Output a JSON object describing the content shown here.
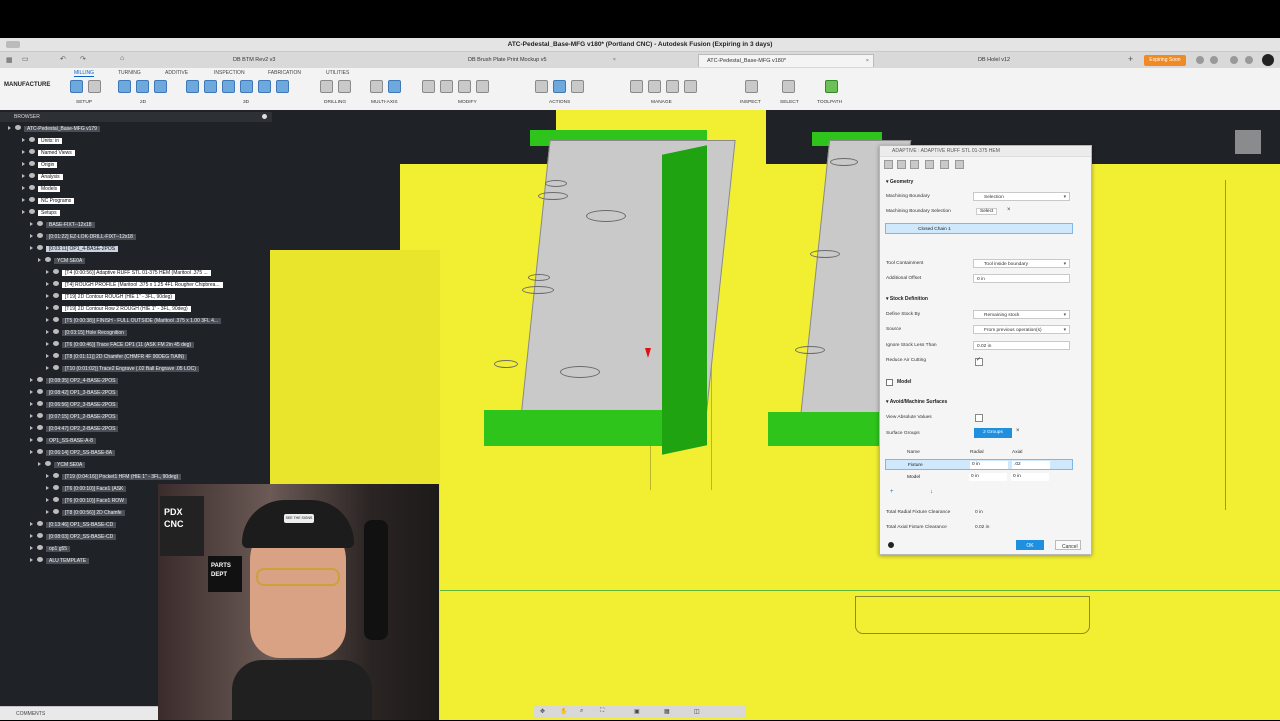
{
  "window": {
    "title": "ATC-Pedestal_Base-MFG v180* (Portland CNC) - Autodesk Fusion (Expiring in 3 days)"
  },
  "doc_tabs": [
    {
      "label": "DB BTM Rev2 v3"
    },
    {
      "label": "DB Brush Plate Print Mockup v5"
    },
    {
      "label": "ATC-Pedestal_Base-MFG v180*"
    },
    {
      "label": "DB Holel v12"
    }
  ],
  "expiring_badge": "Expiring Soon",
  "toolbar": {
    "workspace": "MANUFACTURE",
    "tabs": [
      "MILLING",
      "TURNING",
      "ADDITIVE",
      "INSPECTION",
      "FABRICATION",
      "UTILITIES"
    ],
    "groups": [
      "SETUP",
      "2D",
      "3D",
      "DRILLING",
      "MULTI-AXIS",
      "MODIFY",
      "ACTIONS",
      "MANAGE",
      "INSPECT",
      "SELECT",
      "TOOLPATH"
    ]
  },
  "browser": {
    "header": "BROWSER",
    "rows": [
      {
        "label": "ATC-Pedestal_Base-MFG v179",
        "style": "dark"
      },
      {
        "label": "Units: in",
        "style": "plain"
      },
      {
        "label": "Named Views",
        "style": "plain"
      },
      {
        "label": "Origin",
        "style": "plain"
      },
      {
        "label": "Analysis",
        "style": "plain"
      },
      {
        "label": "Models",
        "style": "plain"
      },
      {
        "label": "NC Programs",
        "style": "plain"
      },
      {
        "label": "Setups",
        "style": "plain"
      },
      {
        "label": "BASE-FIXT--12x18",
        "style": "dark"
      },
      {
        "label": "[0:01:22] EZ-LOK-DRILL-FIXT--12x18",
        "style": "dark"
      },
      {
        "label": "[0:03:11] OP1_4-BASE-2POS",
        "style": "sel"
      },
      {
        "label": "YCM SE0A",
        "style": "dark"
      },
      {
        "label": "[T4 (0:00:56)] Adaptive RUFF STL 01-375 HEM (Maritool .375 ...",
        "style": "plain"
      },
      {
        "label": "[T4] ROUGH PROFILE (Maritool .375 x 1.25 4FL Rougher Chipbrea...",
        "style": "plain"
      },
      {
        "label": "[T19] 2D Contour ROUGH (HIE 1\" - 3FL, 90deg)",
        "style": "plain"
      },
      {
        "label": "[T19] 2D Contour Row 2 ROUGH (HIE 1\" - 3FL, 90deg)",
        "style": "plain"
      },
      {
        "label": "[T5 (0:00:38)] FINISH - FULL OUTSIDE (Maritool .375 x 1.00 3FL 4...",
        "style": "dark"
      },
      {
        "label": "[0:03:15] Hole Recognition",
        "style": "dark"
      },
      {
        "label": "[T6 (0:00:46)] Trace FACE OP1 (11 (ASK FM 2in 45 deg)",
        "style": "dark"
      },
      {
        "label": "[T8 (0:01:11)] 2D Chamfer (CHMFR 4F 90DEG TiAlN)",
        "style": "dark"
      },
      {
        "label": "[T10 (0:01:02)] Trace2 Engrave (.02 Ball Engrave .05 LOC)",
        "style": "dark"
      },
      {
        "label": "[0:08:35] OP2_4-BASE-2POS",
        "style": "dark"
      },
      {
        "label": "[0:08:42] OP1_3-BASE-2POS",
        "style": "dark"
      },
      {
        "label": "[0:06:56] OP2_3-BASE-2POS",
        "style": "dark"
      },
      {
        "label": "[0:07:15] OP1_2-BASE-2POS",
        "style": "dark"
      },
      {
        "label": "[0:04:47] OP2_2-BASE-2POS",
        "style": "dark"
      },
      {
        "label": "OP1_SS-BASE-A-8",
        "style": "dark"
      },
      {
        "label": "[0:06:14] OP2_SS-BASE-8A",
        "style": "dark"
      },
      {
        "label": "YCM SE0A",
        "style": "dark"
      },
      {
        "label": "[T19 (0:04:16)] Pocket1 HFM (HIE 1\" - 3FL, 90deg)",
        "style": "dark"
      },
      {
        "label": "[T6 (0:00:10)] Face1 (ASK",
        "style": "dark"
      },
      {
        "label": "[T6 (0:00:10)] Face1 ROW",
        "style": "dark"
      },
      {
        "label": "[T8 (0:00:56)] 2D Chamfe",
        "style": "dark"
      },
      {
        "label": "[0:13:46] OP1_SS-BASE-CD",
        "style": "dark"
      },
      {
        "label": "[0:08:03] OP2_SS-BASE-CD",
        "style": "dark"
      },
      {
        "label": "op1 g55",
        "style": "dark"
      },
      {
        "label": "ALU TEMPLATE",
        "style": "dark"
      }
    ]
  },
  "dialog": {
    "title": "ADAPTIVE : ADAPTIVE RUFF STL 01-375 HEM",
    "geometry": {
      "section": "Geometry",
      "machining_boundary_label": "Machining Boundary",
      "machining_boundary_value": "Selection",
      "boundary_selection_label": "Machining Boundary Selection",
      "boundary_selection_value": "Select",
      "closed_chain": "Closed Chain 1",
      "tool_containment_label": "Tool Containment",
      "tool_containment_value": "Tool inside boundary",
      "additional_offset_label": "Additional Offset",
      "additional_offset_value": "0 in"
    },
    "stock": {
      "section": "Stock Definition",
      "define_stock_label": "Define Stock By",
      "define_stock_value": "Remaining stock",
      "source_label": "Source",
      "source_value": "From previous operation(s)",
      "ignore_label": "Ignore Stock Less Than",
      "ignore_value": "0.02 in",
      "reduce_label": "Reduce Air Cutting"
    },
    "model": {
      "section": "Model"
    },
    "avoid": {
      "section": "Avoid/Machine Surfaces",
      "view_abs_label": "View Absolute Values",
      "surface_groups_label": "Surface Groups",
      "surface_groups_value": "2 Groups",
      "col_name": "Name",
      "col_radial": "Radial",
      "col_axial": "Axial",
      "rows": [
        {
          "name": "Fixture",
          "radial": "0 in",
          "axial": ".02"
        },
        {
          "name": "Model",
          "radial": "0 in",
          "axial": "0 in"
        }
      ],
      "total_radial_label": "Total Radial Fixture Clearance",
      "total_radial_value": "0 in",
      "total_axial_label": "Total Axial Fixture Clearance",
      "total_axial_value": "0.02 in"
    },
    "ok_label": "OK",
    "cancel_label": "Cancel"
  },
  "comments_label": "COMMENTS",
  "webcam": {
    "hat_text": "SEE THE SIGNS",
    "sign1": "PDX CNC",
    "sign2": "PARTS DEPT"
  }
}
